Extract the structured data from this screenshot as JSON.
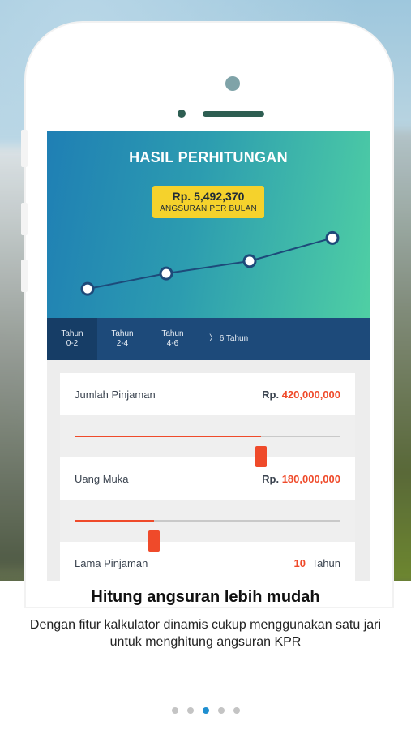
{
  "hero": {
    "title": "HASIL PERHITUNGAN",
    "amount": "Rp. 5,492,370",
    "caption": "ANGSURAN PER BULAN",
    "chart_levels": [
      0.22,
      0.42,
      0.58,
      0.88
    ]
  },
  "tabs": [
    {
      "line1": "Tahun",
      "line2": "0-2",
      "active": true
    },
    {
      "line1": "Tahun",
      "line2": "2-4",
      "active": false
    },
    {
      "line1": "Tahun",
      "line2": "4-6",
      "active": false
    },
    {
      "line1": "〉 6 Tahun",
      "line2": "",
      "active": false
    }
  ],
  "form": {
    "loan": {
      "label": "Jumlah Pinjaman",
      "prefix": "Rp.",
      "value": "420,000,000",
      "slider_fraction": 0.7
    },
    "down_payment": {
      "label": "Uang Muka",
      "prefix": "Rp.",
      "value": "180,000,000",
      "slider_fraction": 0.3
    },
    "term": {
      "label": "Lama Pinjaman",
      "value": "10",
      "unit": "Tahun"
    }
  },
  "onboarding": {
    "headline": "Hitung angsuran lebih mudah",
    "description": "Dengan fitur kalkulator dinamis cukup menggunakan satu jari untuk menghitung angsuran KPR",
    "page_count": 5,
    "active_page": 3
  },
  "colors": {
    "accent": "#ef4a2a",
    "badge": "#f5d22c",
    "tabbar": "#1d4a7a",
    "dot_active": "#1f8fd0"
  }
}
